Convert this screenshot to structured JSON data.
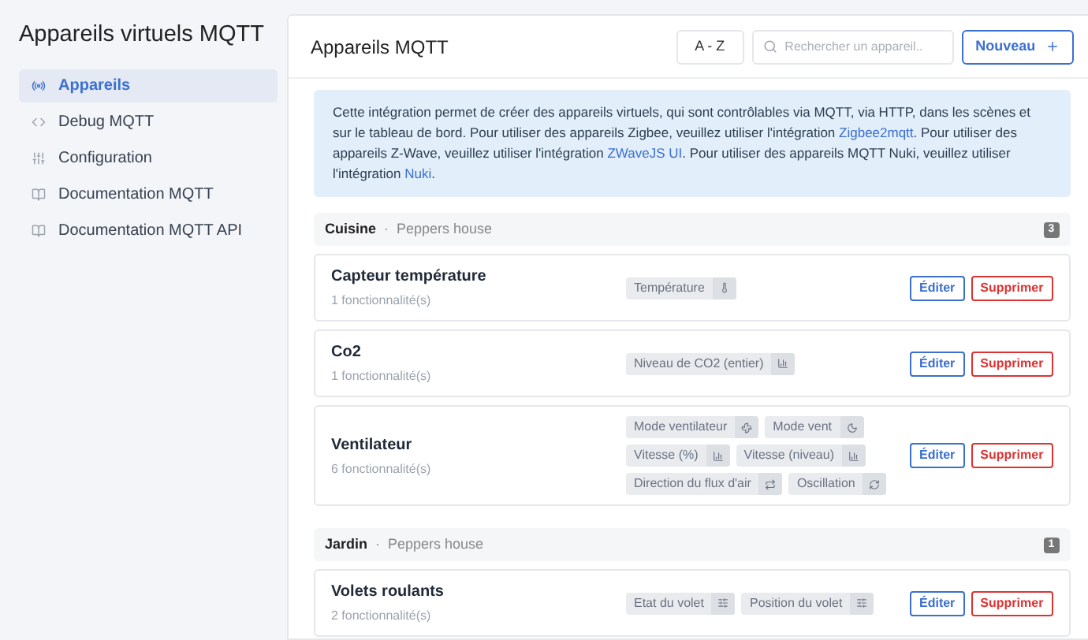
{
  "app_title": "Appareils virtuels MQTT",
  "sidebar": {
    "items": [
      {
        "label": "Appareils",
        "kind": "devices",
        "selected": true
      },
      {
        "label": "Debug MQTT",
        "kind": "debug",
        "selected": false
      },
      {
        "label": "Configuration",
        "kind": "config",
        "selected": false
      },
      {
        "label": "Documentation MQTT",
        "kind": "docs",
        "selected": false
      },
      {
        "label": "Documentation MQTT API",
        "kind": "docs",
        "selected": false
      }
    ]
  },
  "header": {
    "title": "Appareils MQTT",
    "sort": "A - Z",
    "search": {
      "placeholder": "Rechercher un appareil.."
    },
    "new_button": "Nouveau"
  },
  "info": [
    {
      "kind": "text",
      "text": "Cette intégration permet de créer des appareils virtuels, qui sont contrôlables via MQTT, via HTTP, dans les scènes et sur le tableau de bord. Pour utiliser des appareils Zigbee, veuillez utiliser l'intégration "
    },
    {
      "kind": "link",
      "text": "Zigbee2mqtt"
    },
    {
      "kind": "text",
      "text": ". Pour utiliser des appareils Z-Wave, veuillez utiliser l'intégration "
    },
    {
      "kind": "link",
      "text": "ZWaveJS UI"
    },
    {
      "kind": "text",
      "text": ". Pour utiliser des appareils MQTT Nuki, veuillez utiliser l'intégration "
    },
    {
      "kind": "link",
      "text": "Nuki"
    },
    {
      "kind": "text",
      "text": "."
    }
  ],
  "rooms": [
    {
      "name": "Cuisine",
      "separator": "·",
      "house": "Peppers house",
      "count": "3",
      "devices": [
        {
          "name": "Capteur température",
          "features_count": "1 fonctionnalité(s)",
          "edit": "Éditer",
          "delete": "Supprimer",
          "features": [
            {
              "label": "Température",
              "kind": "temperature"
            }
          ]
        },
        {
          "name": "Co2",
          "features_count": "1 fonctionnalité(s)",
          "edit": "Éditer",
          "delete": "Supprimer",
          "features": [
            {
              "label": "Niveau de CO2 (entier)",
              "kind": "level"
            }
          ]
        },
        {
          "name": "Ventilateur",
          "features_count": "6 fonctionnalité(s)",
          "edit": "Éditer",
          "delete": "Supprimer",
          "features": [
            {
              "label": "Mode ventilateur",
              "kind": "fan"
            },
            {
              "label": "Mode vent",
              "kind": "wind"
            },
            {
              "label": "Vitesse (%)",
              "kind": "level"
            },
            {
              "label": "Vitesse (niveau)",
              "kind": "level"
            },
            {
              "label": "Direction du flux d'air",
              "kind": "direction"
            },
            {
              "label": "Oscillation",
              "kind": "oscillation"
            }
          ]
        }
      ]
    },
    {
      "name": "Jardin",
      "separator": "·",
      "house": "Peppers house",
      "count": "1",
      "devices": [
        {
          "name": "Volets roulants",
          "features_count": "2 fonctionnalité(s)",
          "edit": "Éditer",
          "delete": "Supprimer",
          "features": [
            {
              "label": "Etat du volet",
              "kind": "shutter"
            },
            {
              "label": "Position du volet",
              "kind": "shutter"
            }
          ]
        }
      ]
    }
  ]
}
